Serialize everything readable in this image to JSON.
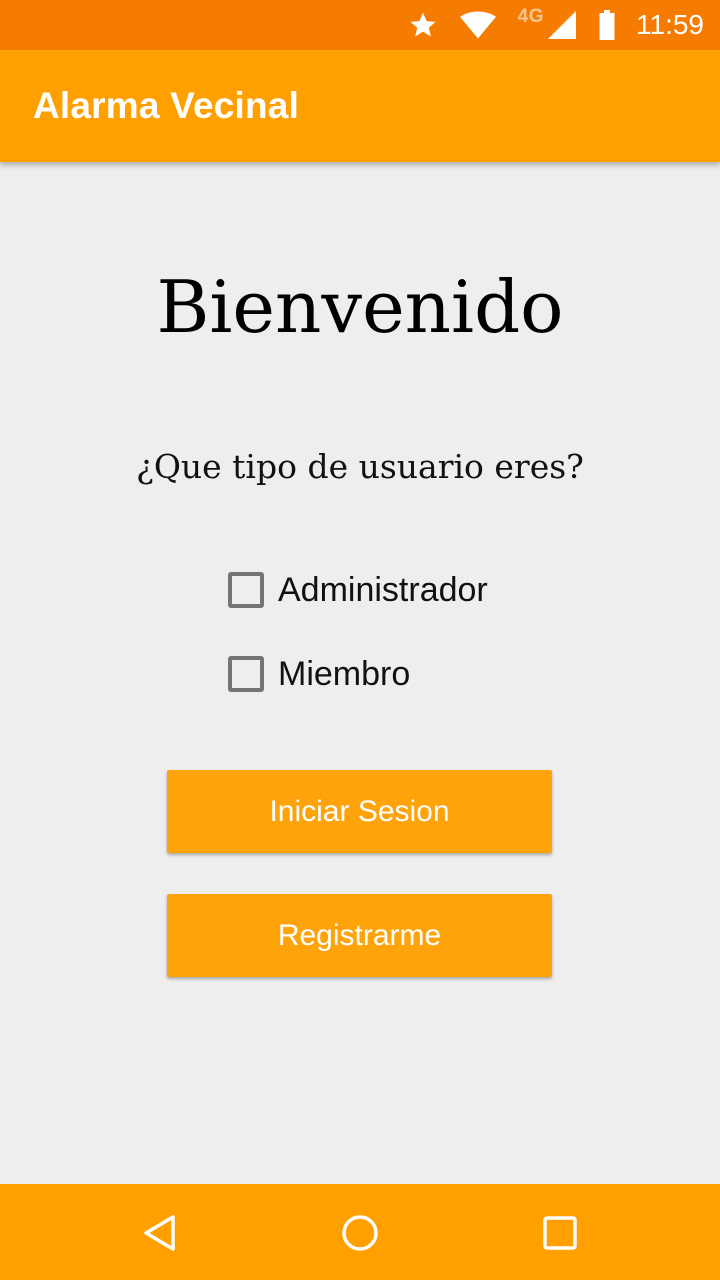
{
  "status_bar": {
    "network": "4G",
    "time": "11:59",
    "icons": [
      "star-icon",
      "wifi-icon",
      "signal-icon",
      "battery-icon"
    ],
    "color": "#f57c00"
  },
  "app_bar": {
    "title": "Alarma Vecinal",
    "color": "#ffa000"
  },
  "main": {
    "welcome": "Bienvenido",
    "question": "¿Que tipo de usuario eres?",
    "options": [
      {
        "label": "Administrador",
        "checked": false
      },
      {
        "label": "Miembro",
        "checked": false
      }
    ],
    "buttons": {
      "login": "Iniciar Sesion",
      "register": "Registrarme"
    },
    "accent": "#ffa30a",
    "background": "#eeeeee"
  },
  "nav_bar": {
    "icons": [
      "back-icon",
      "home-icon",
      "recents-icon"
    ]
  }
}
